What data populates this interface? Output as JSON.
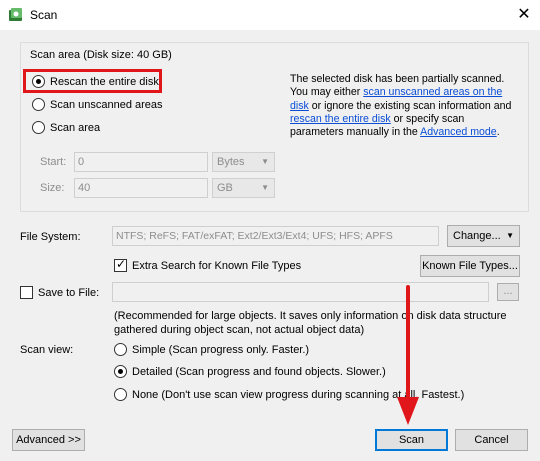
{
  "window": {
    "title": "Scan",
    "close": "✕"
  },
  "scan_area": {
    "legend": "Scan area (Disk size: 40 GB)",
    "options": [
      "Rescan the entire disk",
      "Scan unscanned areas",
      "Scan area"
    ],
    "selected": 0,
    "info": {
      "p1": "The selected disk has been partially scanned. You may either ",
      "link1": "scan unscanned areas on the disk",
      "p2": " or ignore the existing scan information and ",
      "link2": "rescan the entire disk",
      "p3": " or specify scan parameters manually in the ",
      "link3": "Advanced mode",
      "p4": "."
    },
    "start": {
      "label": "Start:",
      "value": "0",
      "unit": "Bytes"
    },
    "size": {
      "label": "Size:",
      "value": "40",
      "unit": "GB"
    }
  },
  "filesystem": {
    "label": "File System:",
    "value": "NTFS; ReFS; FAT/exFAT; Ext2/Ext3/Ext4; UFS; HFS; APFS",
    "change_button": "Change...",
    "extra_search_label": "Extra Search for Known File Types",
    "extra_search_checked": true,
    "known_types_button": "Known File Types..."
  },
  "save": {
    "label": "Save to File:",
    "checked": false,
    "path": "",
    "browse": "...",
    "note": "(Recommended for large objects. It saves only information on disk data structure gathered during object scan, not actual object data)"
  },
  "scan_view": {
    "label": "Scan view:",
    "options": [
      "Simple (Scan progress only. Faster.)",
      "Detailed (Scan progress and found objects. Slower.)",
      "None (Don't use scan view progress during scanning at all. Fastest.)"
    ],
    "selected": 1
  },
  "footer": {
    "advanced": "Advanced >>",
    "scan": "Scan",
    "cancel": "Cancel"
  },
  "colors": {
    "highlight": "#e0161b",
    "link": "#0a4ed6",
    "default_border": "#0078d7"
  }
}
